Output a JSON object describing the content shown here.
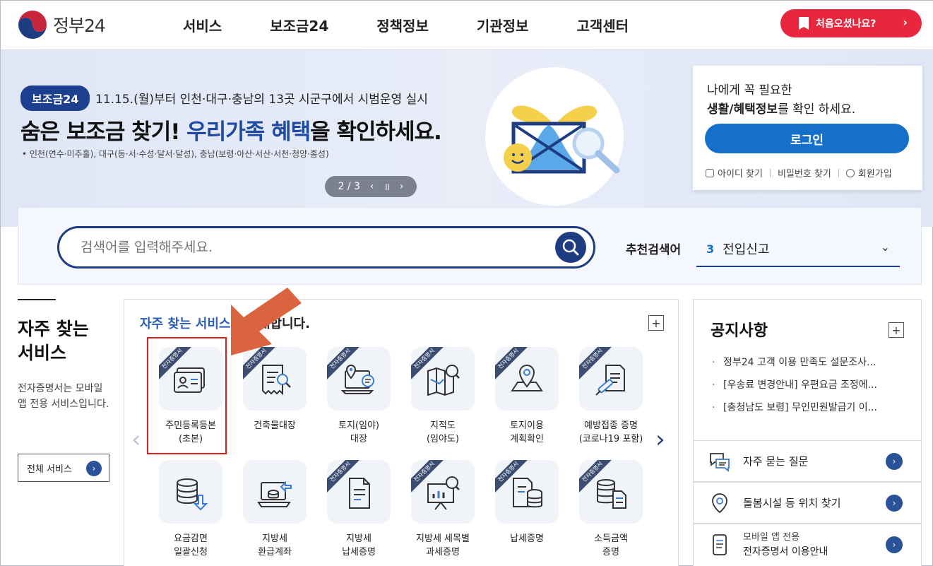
{
  "header": {
    "logo_text": "정부24",
    "nav": [
      "서비스",
      "보조금24",
      "정책정보",
      "기관정보",
      "고객센터"
    ],
    "first_visit_label": "처음오셨나요?",
    "first_visit_chevron": "›"
  },
  "banner": {
    "badge": "보조금24",
    "subheadline": "11.15.(월)부터 인천·대구·충남의 13곳 시군구에서 시범운영 실시",
    "headline_before": "숨은 보조금 찾기!",
    "headline_highlight": "우리가족 혜택",
    "headline_after": "을 확인하세요.",
    "areas": "• 인천(연수·미추홀), 대구(동·서·수성·달서·달성), 충남(보령·아산·서산·서천·청양·홍성)",
    "pager": {
      "page": "2 / 3",
      "prev": "‹",
      "pause": "॥",
      "next": "›"
    }
  },
  "login": {
    "line1": "나에게 꼭 필요한",
    "line2_bold": "생활/혜택정보",
    "line2_rest": "를 확인 하세요.",
    "button": "로그인",
    "find_id": "아이디 찾기",
    "find_pw": "비밀번호 찾기",
    "signup": "회원가입"
  },
  "search": {
    "placeholder": "검색어를 입력해주세요.",
    "rec_label": "추천검색어",
    "rec_num": "3",
    "rec_term": "전입신고"
  },
  "left": {
    "title": "자주 찾는 서비스",
    "desc": "전자증명서는 모바일 앱 전용 서비스입니다.",
    "all_button": "전체 서비스"
  },
  "services": {
    "heading_blue": "자주 찾는 서비스",
    "heading_rest": "를 안내합니다.",
    "ribbon": "전자증명서",
    "items": [
      {
        "line1": "주민등록등본",
        "line2": "(초본)",
        "icon": "id-card-icon"
      },
      {
        "line1": "건축물대장",
        "line2": "",
        "icon": "receipt-search-icon"
      },
      {
        "line1": "토지(임야)",
        "line2": "대장",
        "icon": "laptop-location-icon"
      },
      {
        "line1": "지적도",
        "line2": "(임야도)",
        "icon": "map-search-icon"
      },
      {
        "line1": "토지이용",
        "line2": "계획확인",
        "icon": "map-pin-icon"
      },
      {
        "line1": "예방접종 증명",
        "line2": "(코로나19 포함)",
        "icon": "syringe-document-icon"
      },
      {
        "line1": "요금감면",
        "line2": "일괄신청",
        "icon": "coins-download-icon"
      },
      {
        "line1": "지방세",
        "line2": "환급계좌",
        "icon": "laptop-coins-icon"
      },
      {
        "line1": "지방세",
        "line2": "납세증명",
        "icon": "document-icon"
      },
      {
        "line1": "지방세 세목별",
        "line2": "과세증명",
        "icon": "chart-board-icon"
      },
      {
        "line1": "납세증명",
        "line2": "",
        "icon": "document-coins-icon"
      },
      {
        "line1": "소득금액",
        "line2": "증명",
        "icon": "coins-document-icon"
      }
    ]
  },
  "notice": {
    "title": "공지사항",
    "items": [
      "정부24 고객 이용 만족도 설문조사...",
      "[우송료 변경안내] 우편요금 조정에...",
      "[충청남도 보령] 무인민원발급기 이..."
    ]
  },
  "quick": [
    {
      "label": "자주 묻는 질문"
    },
    {
      "label": "돌봄시설 등 위치 찾기"
    },
    {
      "small": "모바일 앱 전용",
      "label": "전자증명서 이용안내"
    }
  ],
  "colors": {
    "brand_navy": "#1e3c82",
    "login_blue": "#1470c8",
    "accent_red": "#e8263e",
    "highlight_box": "#e02020",
    "arrow_orange": "#d9643f"
  }
}
